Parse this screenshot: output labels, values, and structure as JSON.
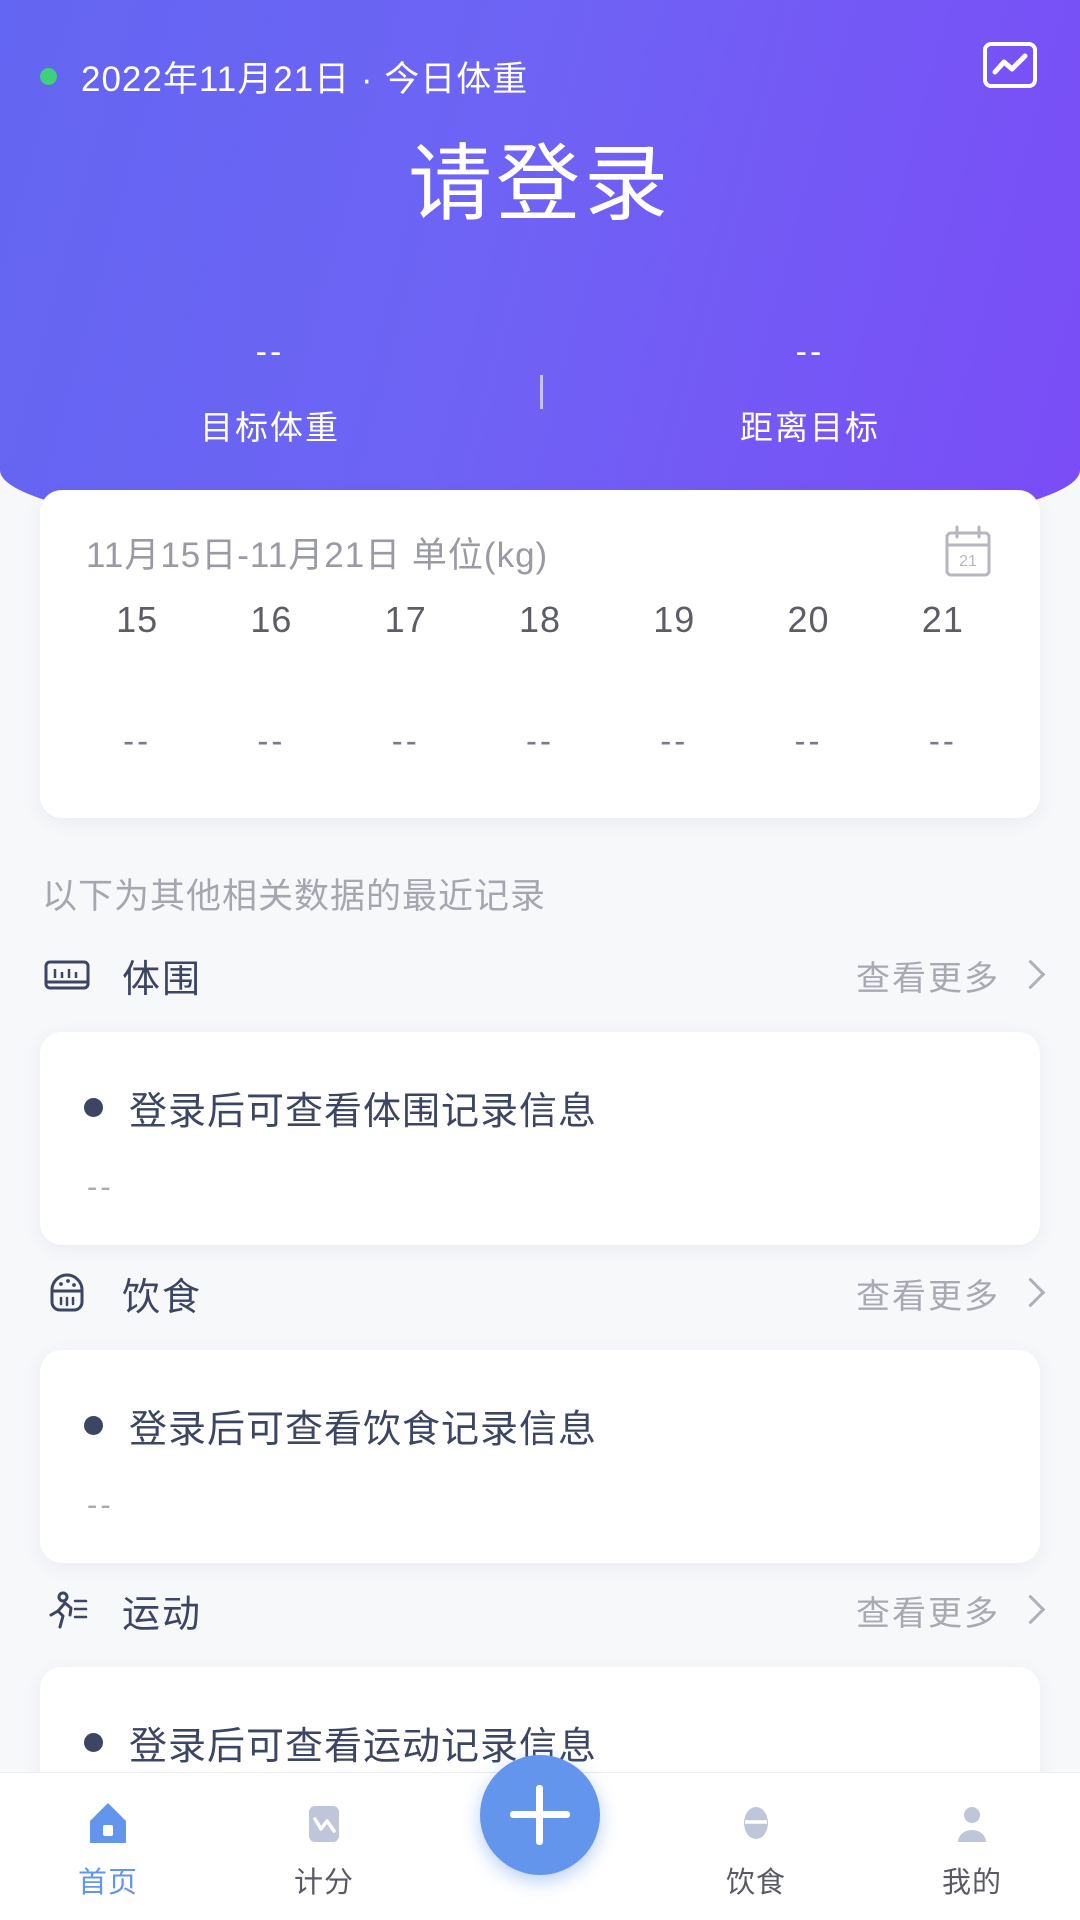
{
  "header": {
    "status_dot": "green",
    "date_title": "2022年11月21日 · 今日体重",
    "trend_icon": "trend-chart-icon",
    "main_title": "请登录",
    "stats": [
      {
        "value": "--",
        "label": "目标体重"
      },
      {
        "value": "--",
        "label": "距离目标"
      }
    ]
  },
  "weight_card": {
    "range_label": "11月15日-11月21日  单位(kg)",
    "calendar_icon": "calendar-icon",
    "calendar_day": "21",
    "days": [
      "15",
      "16",
      "17",
      "18",
      "19",
      "20",
      "21"
    ],
    "values": [
      "--",
      "--",
      "--",
      "--",
      "--",
      "--",
      "--"
    ]
  },
  "section_note": "以下为其他相关数据的最近记录",
  "more_label": "查看更多",
  "groups": [
    {
      "icon": "measuring-tape-icon",
      "title": "体围",
      "record_text": "登录后可查看体围记录信息",
      "record_sub": "--"
    },
    {
      "icon": "food-bowl-icon",
      "title": "饮食",
      "record_text": "登录后可查看饮食记录信息",
      "record_sub": "--"
    },
    {
      "icon": "running-person-icon",
      "title": "运动",
      "record_text": "登录后可查看运动记录信息",
      "record_sub": "--"
    }
  ],
  "tabbar": {
    "items": [
      {
        "icon": "home-icon",
        "label": "首页",
        "active": true
      },
      {
        "icon": "score-chart-icon",
        "label": "计分",
        "active": false
      },
      {
        "icon": "plus-icon",
        "label": "",
        "active": false
      },
      {
        "icon": "diet-icon",
        "label": "饮食",
        "active": false
      },
      {
        "icon": "person-icon",
        "label": "我的",
        "active": false
      }
    ]
  },
  "colors": {
    "hero_gradient_start": "#6366F2",
    "hero_gradient_end": "#7B4CF7",
    "accent_blue": "#6495ED",
    "text_navy": "#3C4663",
    "text_muted": "#A9A9B4",
    "status_dot_green": "#3ED07A"
  }
}
